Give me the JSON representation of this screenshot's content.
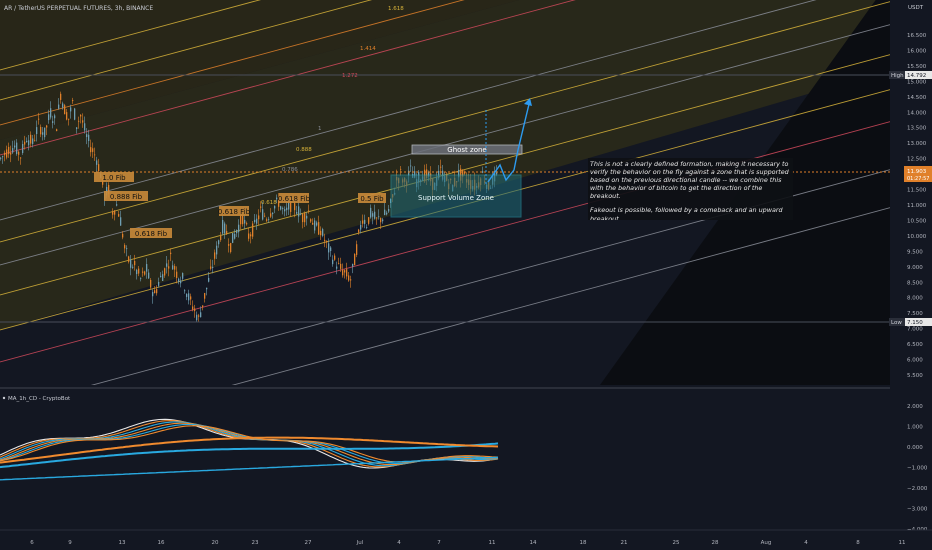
{
  "header": {
    "symbol_title": "AR / TetherUS PERPETUAL FUTURES, 3h, BINANCE",
    "currency": "USDT"
  },
  "colors": {
    "background": "#131722",
    "up_candle": "#6f9fb3",
    "down_candle": "#e0802a",
    "fib_yellow": "#d9b43a",
    "fib_red": "#d24a5c",
    "fib_grey": "#8a8e98",
    "ghost_zone": "#9fa3ad",
    "support_zone": "#2aa3b5",
    "arrow": "#2d9bf0",
    "osc_blue": "#29a9e0",
    "osc_orange": "#f08a2e"
  },
  "price_axis": {
    "ticks": [
      "16.500",
      "16.000",
      "15.500",
      "15.000",
      "14.500",
      "14.000",
      "13.500",
      "13.000",
      "12.500",
      "12.000",
      "11.500",
      "11.000",
      "10.500",
      "10.000",
      "9.500",
      "9.000",
      "8.500",
      "8.000",
      "7.500",
      "7.000",
      "6.500",
      "6.000",
      "5.500"
    ],
    "high_label": "High",
    "high_value": "14.792",
    "low_label": "Low",
    "low_value": "7.150",
    "last_price": "11.903",
    "last_countdown": "01:27:57"
  },
  "osc_axis": {
    "ticks": [
      "2.000",
      "1.000",
      "0.000",
      "−1.000",
      "−2.000",
      "−3.000",
      "−4.000"
    ]
  },
  "time_axis": {
    "ticks": [
      "6",
      "9",
      "13",
      "16",
      "20",
      "23",
      "27",
      "Jul",
      "4",
      "7",
      "11",
      "14",
      "18",
      "21",
      "25",
      "28",
      "Aug",
      "4",
      "8",
      "11"
    ]
  },
  "fib_channel_labels": [
    {
      "text": "1.618",
      "id": "1618"
    },
    {
      "text": "1.414",
      "id": "1414"
    },
    {
      "text": "1.272",
      "id": "1272"
    },
    {
      "text": "1",
      "id": "1"
    },
    {
      "text": "0.888",
      "id": "0888"
    },
    {
      "text": "0.786",
      "id": "0786"
    },
    {
      "text": "0.618",
      "id": "0618"
    }
  ],
  "fib_tags": [
    "1.0 Fib",
    "0.888 Fib",
    "0.618 Fib",
    "0.618 Fib",
    "0.618 Fib",
    "0.5 Fib"
  ],
  "zones": {
    "ghost": "Ghost zone",
    "support": "Support Volume Zone"
  },
  "annotation": {
    "paragraph1": "This is not a clearly defined formation, making it necessary to verify the behavior on the fly against a zone that is supported based on the previous directional candle -- we combine this with the behavior of bitcoin to get the direction of the breakout.",
    "paragraph2": "Fakeout is possible, followed by a comeback and an upward breakout"
  },
  "indicator": {
    "name": "MA_1h_CD - CryptoBot"
  },
  "chart_data": {
    "type": "candlestick",
    "title": "AR / TetherUS PERPETUAL FUTURES, 3h, BINANCE",
    "price_range": [
      5.2,
      17.0
    ],
    "close_path": [
      [
        0,
        12.5
      ],
      [
        8,
        12.8
      ],
      [
        14,
        12.9
      ],
      [
        20,
        12.6
      ],
      [
        26,
        13.2
      ],
      [
        32,
        13.0
      ],
      [
        38,
        13.6
      ],
      [
        44,
        13.3
      ],
      [
        50,
        14.0
      ],
      [
        56,
        13.6
      ],
      [
        60,
        14.6
      ],
      [
        64,
        14.1
      ],
      [
        68,
        13.8
      ],
      [
        72,
        14.3
      ],
      [
        76,
        13.6
      ],
      [
        80,
        13.9
      ],
      [
        86,
        13.2
      ],
      [
        90,
        12.9
      ],
      [
        96,
        12.5
      ],
      [
        100,
        12.0
      ],
      [
        104,
        11.3
      ],
      [
        108,
        11.5
      ],
      [
        112,
        10.8
      ],
      [
        116,
        11.0
      ],
      [
        120,
        10.5
      ],
      [
        124,
        9.6
      ],
      [
        128,
        9.2
      ],
      [
        134,
        9.0
      ],
      [
        140,
        8.6
      ],
      [
        146,
        8.9
      ],
      [
        150,
        8.4
      ],
      [
        154,
        8.1
      ],
      [
        158,
        8.5
      ],
      [
        164,
        8.9
      ],
      [
        170,
        9.3
      ],
      [
        176,
        8.8
      ],
      [
        182,
        8.6
      ],
      [
        188,
        8.0
      ],
      [
        194,
        7.6
      ],
      [
        198,
        7.3
      ],
      [
        202,
        7.8
      ],
      [
        206,
        8.3
      ],
      [
        210,
        8.8
      ],
      [
        214,
        9.3
      ],
      [
        218,
        9.8
      ],
      [
        222,
        10.3
      ],
      [
        226,
        10.1
      ],
      [
        230,
        9.7
      ],
      [
        236,
        10.2
      ],
      [
        242,
        10.6
      ],
      [
        248,
        10.0
      ],
      [
        254,
        10.3
      ],
      [
        260,
        10.8
      ],
      [
        266,
        10.6
      ],
      [
        272,
        10.9
      ],
      [
        278,
        11.1
      ],
      [
        284,
        10.7
      ],
      [
        290,
        11.0
      ],
      [
        296,
        10.9
      ],
      [
        302,
        10.6
      ],
      [
        308,
        10.8
      ],
      [
        314,
        10.3
      ],
      [
        320,
        10.2
      ],
      [
        326,
        9.7
      ],
      [
        332,
        9.3
      ],
      [
        338,
        9.0
      ],
      [
        344,
        8.8
      ],
      [
        350,
        8.6
      ],
      [
        354,
        9.2
      ],
      [
        358,
        10.0
      ],
      [
        362,
        10.6
      ],
      [
        366,
        10.4
      ],
      [
        370,
        10.7
      ],
      [
        376,
        10.5
      ],
      [
        382,
        10.6
      ],
      [
        388,
        10.8
      ],
      [
        392,
        11.2
      ],
      [
        396,
        11.8
      ],
      [
        400,
        12.0
      ],
      [
        404,
        11.7
      ],
      [
        410,
        12.1
      ],
      [
        416,
        11.8
      ],
      [
        422,
        12.0
      ],
      [
        428,
        11.9
      ],
      [
        434,
        11.6
      ],
      [
        440,
        12.1
      ],
      [
        446,
        11.8
      ],
      [
        452,
        11.6
      ],
      [
        458,
        12.0
      ],
      [
        464,
        11.9
      ],
      [
        470,
        11.7
      ],
      [
        476,
        11.6
      ],
      [
        482,
        12.0
      ],
      [
        488,
        11.6
      ],
      [
        494,
        11.9
      ],
      [
        498,
        11.9
      ]
    ],
    "high": 14.792,
    "low": 7.15,
    "last": 11.903
  }
}
